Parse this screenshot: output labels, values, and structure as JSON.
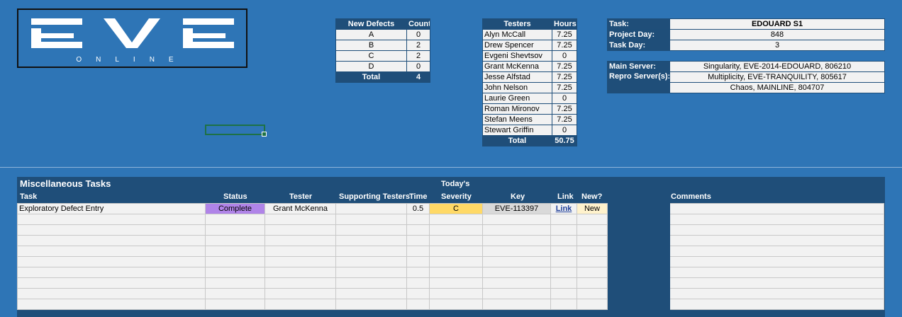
{
  "logo": {
    "main": "EVE",
    "sub": "ONLINE"
  },
  "defects": {
    "headers": [
      "New Defects",
      "Count"
    ],
    "rows": [
      [
        "A",
        "0"
      ],
      [
        "B",
        "2"
      ],
      [
        "C",
        "2"
      ],
      [
        "D",
        "0"
      ]
    ],
    "total_label": "Total",
    "total": "4"
  },
  "testers": {
    "headers": [
      "Testers",
      "Hours"
    ],
    "rows": [
      [
        "Alyn McCall",
        "7.25"
      ],
      [
        "Drew Spencer",
        "7.25"
      ],
      [
        "Evgeni Shevtsov",
        "0"
      ],
      [
        "Grant McKenna",
        "7.25"
      ],
      [
        "Jesse Alfstad",
        "7.25"
      ],
      [
        "John Nelson",
        "7.25"
      ],
      [
        "Laurie Green",
        "0"
      ],
      [
        "Roman Mironov",
        "7.25"
      ],
      [
        "Stefan Meens",
        "7.25"
      ],
      [
        "Stewart Griffin",
        "0"
      ]
    ],
    "total_label": "Total",
    "total": "50.75"
  },
  "task": {
    "task_label": "Task:",
    "task_value": "EDOUARD S1",
    "project_day_label": "Project Day:",
    "project_day": "848",
    "task_day_label": "Task Day:",
    "task_day": "3"
  },
  "servers": {
    "main_label": "Main Server:",
    "main": "Singularity, EVE-2014-EDOUARD, 806210",
    "repro_label": "Repro Server(s):",
    "repro_1": "Multiplicity, EVE-TRANQUILITY, 805617",
    "repro_2": "Chaos, MAINLINE, 804707"
  },
  "misc": {
    "title": "Miscellaneous Tasks",
    "todays": "Today's",
    "columns": {
      "task": "Task",
      "status": "Status",
      "tester": "Tester",
      "supporting": "Supporting Testers",
      "time": "Time",
      "severity": "Severity",
      "key": "Key",
      "link": "Link",
      "new": "New?",
      "comments": "Comments"
    },
    "row1": {
      "task": "Exploratory Defect Entry",
      "status": "Complete",
      "tester": "Grant McKenna",
      "supporting": "",
      "time": "0.5",
      "severity": "C",
      "key": "EVE-113397",
      "link": "Link",
      "new": "New",
      "comments": ""
    }
  }
}
